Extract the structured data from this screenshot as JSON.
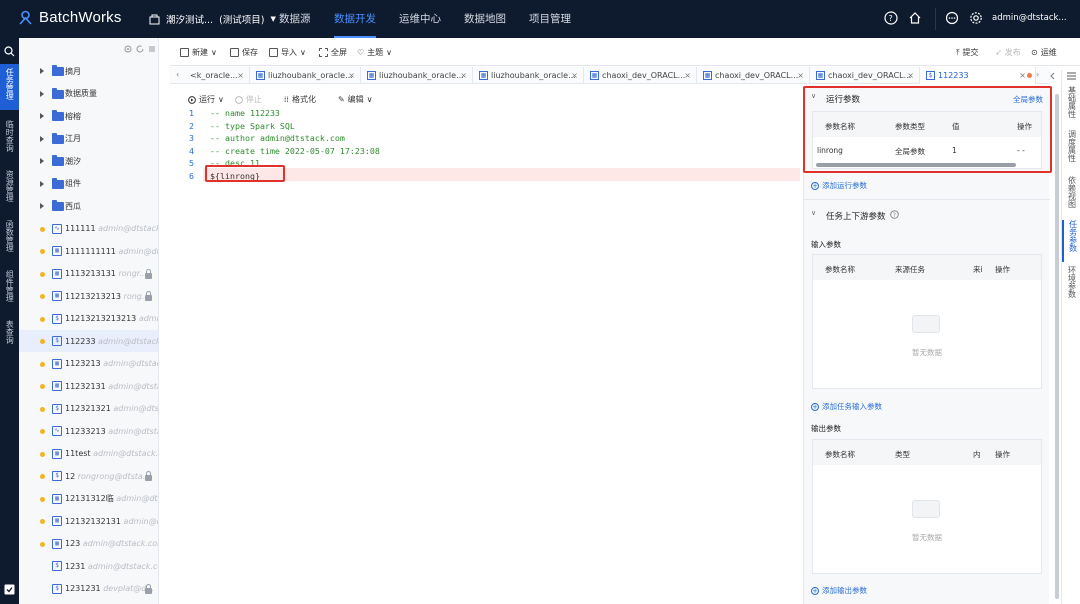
{
  "header": {
    "app_name": "BatchWorks",
    "project": "潮汐测试...",
    "project_tag": "(测试项目)",
    "nav": [
      "数据源",
      "数据开发",
      "运维中心",
      "数据地图",
      "项目管理"
    ],
    "active_nav": "数据开发",
    "user": "admin@dtstack..."
  },
  "left_rail": {
    "items": [
      "任务管理",
      "临时查询",
      "资源管理",
      "函数管理",
      "组件管理",
      "表查询"
    ],
    "active": "任务管理"
  },
  "tree": {
    "folders": [
      "摘月",
      "数据质量",
      "榕榕",
      "江月",
      "潮汐",
      "组件",
      "西瓜"
    ],
    "files": [
      {
        "icon": "flow",
        "name": "111111",
        "author": "admin@dtstack...",
        "locked": false
      },
      {
        "icon": "grid",
        "name": "1111111111",
        "author": "admin@dts...",
        "locked": false
      },
      {
        "icon": "grid",
        "name": "1113213131",
        "author": "rongr...",
        "locked": true
      },
      {
        "icon": "grid",
        "name": "11213213213",
        "author": "rong...",
        "locked": true
      },
      {
        "icon": "sql",
        "name": "11213213213213",
        "author": "admi...",
        "locked": false
      },
      {
        "icon": "sql",
        "name": "112233",
        "author": "admin@dtstack...",
        "locked": false,
        "selected": true
      },
      {
        "icon": "grid",
        "name": "1123213",
        "author": "admin@dtstac...",
        "locked": false
      },
      {
        "icon": "grid",
        "name": "11232131",
        "author": "admin@dtsta...",
        "locked": false
      },
      {
        "icon": "sql",
        "name": "112321321",
        "author": "admin@dtst...",
        "locked": false
      },
      {
        "icon": "flow",
        "name": "11233213",
        "author": "admin@dtsta...",
        "locked": false
      },
      {
        "icon": "grid",
        "name": "11test",
        "author": "admin@dtstack.c...",
        "locked": false
      },
      {
        "icon": "sql",
        "name": "12",
        "author": "rongrong@dtsta...",
        "locked": true
      },
      {
        "icon": "grid",
        "name": "12131312临",
        "author": "admin@dts...",
        "locked": false
      },
      {
        "icon": "grid",
        "name": "12132132131",
        "author": "admin@d...",
        "locked": false
      },
      {
        "icon": "grid",
        "name": "123",
        "author": "admin@dtstack.com...",
        "locked": false
      },
      {
        "icon": "sql",
        "name": "1231",
        "author": "admin@dtstack.co...",
        "locked": false
      },
      {
        "icon": "sql",
        "name": "1231231",
        "author": "devplat@d...",
        "locked": true
      }
    ]
  },
  "toolbar": {
    "new": "新建",
    "save": "保存",
    "import": "导入",
    "fullscreen": "全屏",
    "theme": "主题",
    "submit": "提交",
    "publish": "发布",
    "ops": "运维"
  },
  "tabs": [
    {
      "label": "<k_oracle...",
      "icon": ""
    },
    {
      "label": "liuzhoubank_oracle...",
      "icon": "grid"
    },
    {
      "label": "liuzhoubank_oracle...",
      "icon": "grid"
    },
    {
      "label": "liuzhoubank_oracle...",
      "icon": "grid"
    },
    {
      "label": "chaoxi_dev_ORACL...",
      "icon": "grid"
    },
    {
      "label": "chaoxi_dev_ORACL...",
      "icon": "grid"
    },
    {
      "label": "chaoxi_dev_ORACL...",
      "icon": "grid"
    },
    {
      "label": "112233",
      "icon": "sql",
      "active": true
    }
  ],
  "editor_bar": {
    "run": "运行",
    "stop": "停止",
    "format": "格式化",
    "edit": "编辑"
  },
  "code_lines": [
    "-- name 112233",
    "-- type Spark SQL",
    "-- author admin@dtstack.com",
    "-- create time 2022-05-07 17:23:08",
    "-- desc 11",
    "${linrong}"
  ],
  "panel": {
    "run_params_title": "运行参数",
    "global_params_link": "全局参数",
    "run_params_headers": [
      "参数名称",
      "参数类型",
      "值",
      "操作"
    ],
    "run_params_rows": [
      [
        "linrong",
        "全局参数",
        "1",
        "- -"
      ]
    ],
    "add_run_param": "添加运行参数",
    "upstream_title": "任务上下游参数",
    "input_title": "输入参数",
    "input_headers": [
      "参数名称",
      "来源任务",
      "来i",
      "操作"
    ],
    "empty_text": "暂无数据",
    "add_input": "添加任务输入参数",
    "output_title": "输出参数",
    "output_headers": [
      "参数名称",
      "类型",
      "内"
    ],
    "output_op": "操作",
    "add_output": "添加输出参数"
  },
  "vtabs": [
    "基础属性",
    "调度属性",
    "依赖视图",
    "任务参数",
    "环境参数"
  ],
  "active_vtab": "任务参数"
}
